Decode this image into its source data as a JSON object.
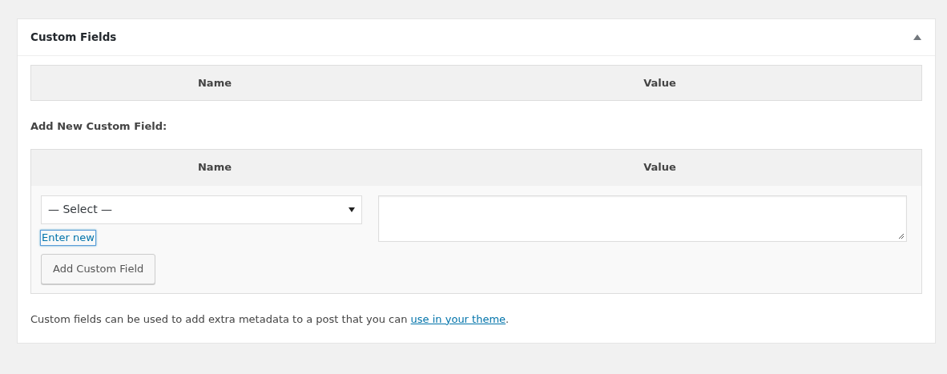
{
  "panel": {
    "title": "Custom Fields",
    "expanded": true
  },
  "existing_table": {
    "columns": [
      "Name",
      "Value"
    ]
  },
  "add_new": {
    "heading": "Add New Custom Field:",
    "columns": [
      "Name",
      "Value"
    ],
    "name_select": {
      "value": "— Select —"
    },
    "enter_new_link": {
      "label": "Enter new",
      "focused": true
    },
    "button": "Add Custom Field"
  },
  "footer": {
    "text": "Custom fields can be used to add extra metadata to a post that you can ",
    "link": "use in your theme",
    "end": "."
  }
}
